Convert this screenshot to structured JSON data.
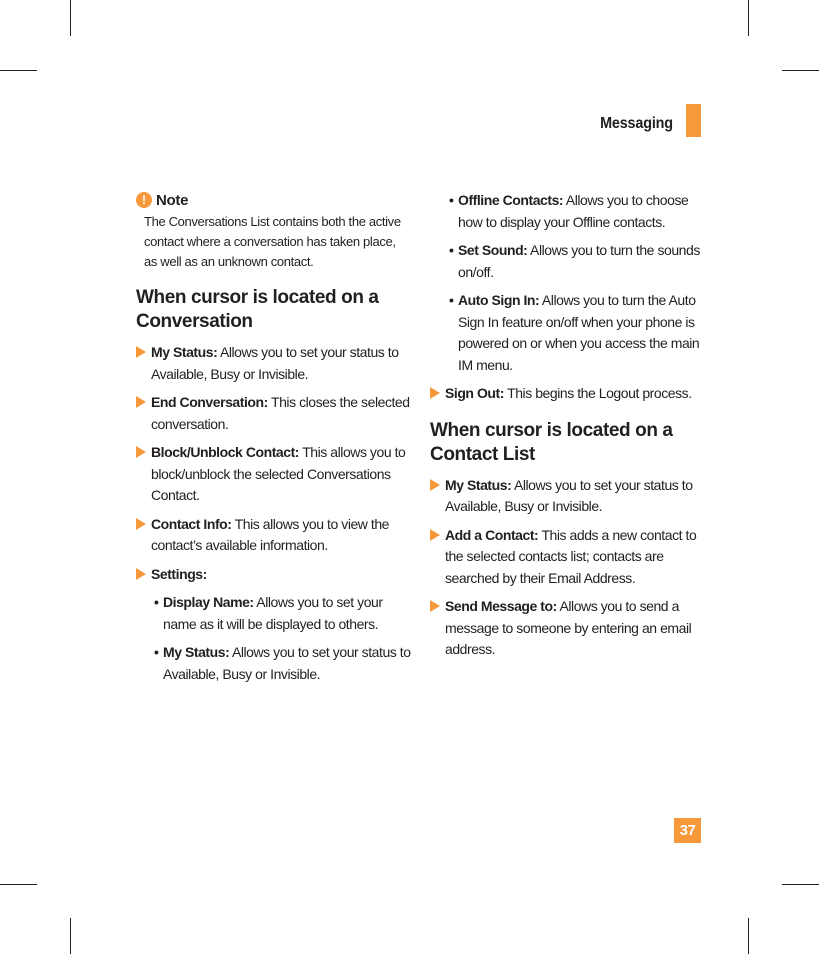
{
  "header": {
    "section_title": "Messaging",
    "accent_color": "#f7993a"
  },
  "note": {
    "icon": "exclamation-icon",
    "icon_glyph": "!",
    "label": "Note",
    "body": "The Conversations List contains both the active contact where a conversation has taken place, as well as an unknown contact."
  },
  "sections": [
    {
      "title": "When cursor is located on a Conversation",
      "items": [
        {
          "term": "My Status:",
          "desc": " Allows you to set your status to Available, Busy or Invisible."
        },
        {
          "term": "End Conversation:",
          "desc": " This closes the selected conversation."
        },
        {
          "term": "Block/Unblock Contact:",
          "desc": " This allows you to block/unblock the selected Conversations Contact."
        },
        {
          "term": "Contact Info:",
          "desc": " This allows you to view the contact’s available information."
        },
        {
          "term": "Settings:",
          "desc": "",
          "subitems": [
            {
              "term": "Display Name:",
              "desc": " Allows you to set your name as it will be displayed to others."
            },
            {
              "term": "My Status:",
              "desc": " Allows you to set your status to Available, Busy or Invisible."
            },
            {
              "term": "Offline Contacts:",
              "desc": " Allows you to choose how to display your Offline contacts."
            },
            {
              "term": "Set Sound:",
              "desc": " Allows you to turn the sounds on/off."
            },
            {
              "term": "Auto Sign In:",
              "desc": " Allows you to turn the Auto Sign In feature on/off when your phone is powered on or when you access the main IM menu."
            }
          ]
        },
        {
          "term": "Sign Out:",
          "desc": " This begins the Logout process."
        }
      ]
    },
    {
      "title": "When cursor is located on a Contact List",
      "items": [
        {
          "term": "My Status:",
          "desc": " Allows you to set your status to Available, Busy or Invisible."
        },
        {
          "term": "Add a Contact:",
          "desc": " This adds a new contact to the selected contacts list; contacts are searched by their Email Address."
        },
        {
          "term": "Send Message to:",
          "desc": " Allows you to send a message to someone by entering an email address."
        }
      ]
    }
  ],
  "footer": {
    "page_number": "37"
  }
}
